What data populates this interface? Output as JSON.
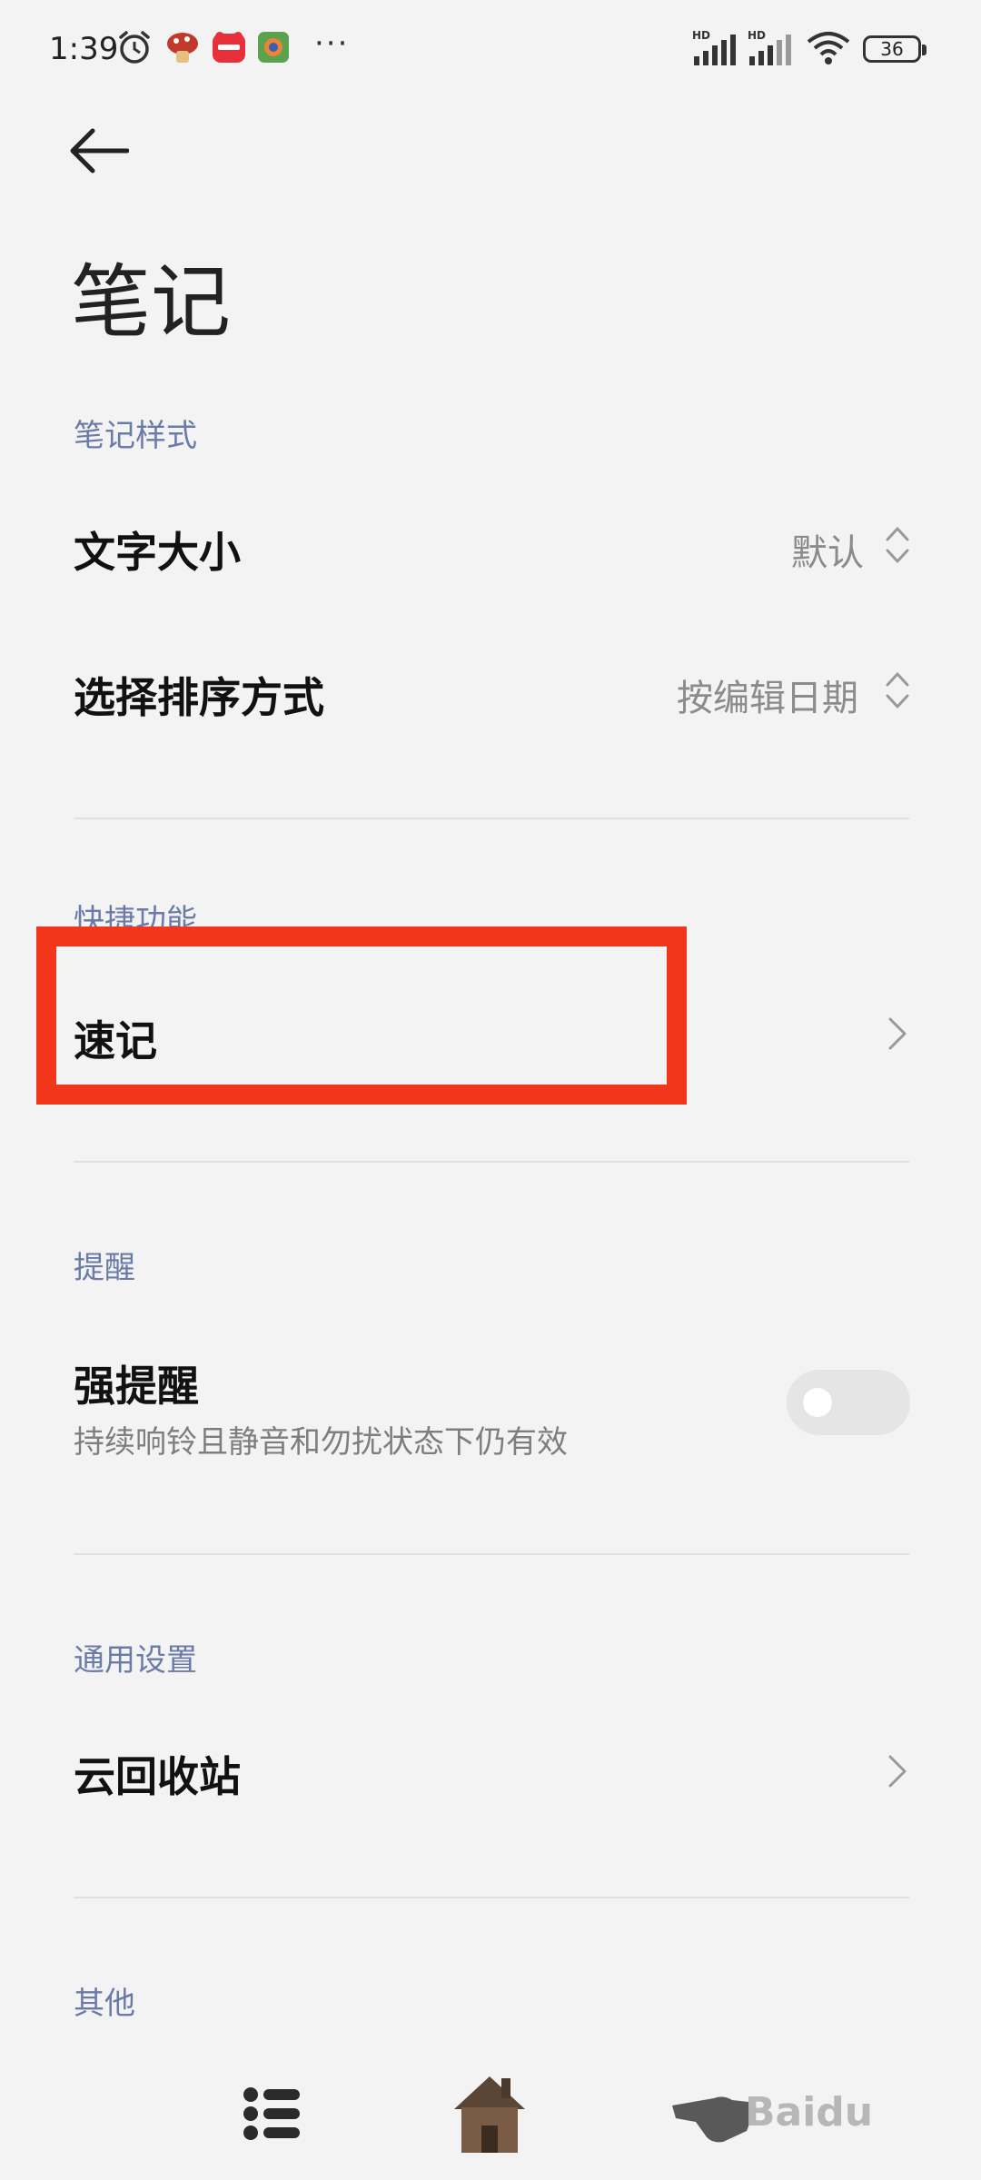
{
  "status_bar": {
    "time": "1:39",
    "battery": "36",
    "icons": [
      "alarm-icon",
      "mushroom-app-icon",
      "xiaohongshu-app-icon",
      "game-app-icon",
      "more-dots-icon",
      "hd-signal-icon",
      "hd-signal-icon",
      "wifi-icon",
      "battery-icon"
    ],
    "more": "···"
  },
  "header": {
    "title": "笔记"
  },
  "sections": {
    "note_style": {
      "header": "笔记样式",
      "font_size_label": "文字大小",
      "font_size_value": "默认",
      "sort_label": "选择排序方式",
      "sort_value": "按编辑日期"
    },
    "shortcuts": {
      "header": "快捷功能",
      "quick_note_label": "速记"
    },
    "reminder": {
      "header": "提醒",
      "strong_label": "强提醒",
      "strong_desc": "持续响铃且静音和勿扰状态下仍有效",
      "strong_enabled": false
    },
    "general": {
      "header": "通用设置",
      "trash_label": "云回收站"
    },
    "other": {
      "header": "其他"
    }
  },
  "annotation": {
    "highlight_color": "#f2361c"
  },
  "watermark": "Baidu"
}
